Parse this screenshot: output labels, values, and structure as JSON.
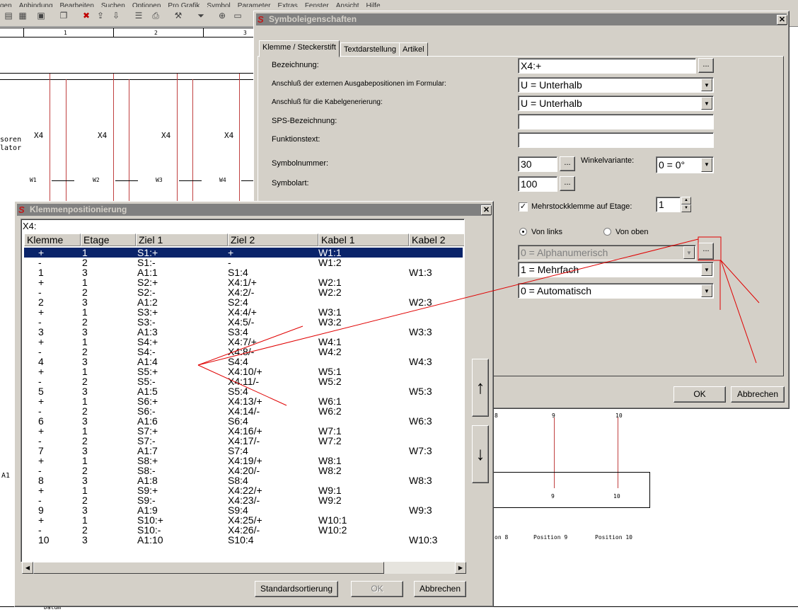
{
  "menubar": [
    "gen",
    "Anbindung",
    "Bearbeiten",
    "Suchen",
    "Optionen",
    "Pro Grafik",
    "Symbol",
    "Parameter",
    "Extras",
    "Fenster",
    "Ansicht",
    "Hilfe"
  ],
  "ruler": [
    "1",
    "2",
    "3"
  ],
  "schematic": {
    "side_text_1": "soren",
    "side_text_2": "lator",
    "terminals": [
      "X4",
      "X4",
      "X4",
      "X4"
    ],
    "wires": [
      "W1",
      "W2",
      "W3",
      "W4"
    ],
    "a1_label": "A1",
    "lower_nums": [
      "8",
      "9",
      "10"
    ],
    "lower_box_nums": [
      "9",
      "10"
    ],
    "positions": [
      "on 8",
      "Position 9",
      "Position 10"
    ],
    "bottom_left": "Datum"
  },
  "symbol_dialog": {
    "title": "Symboleigenschaften",
    "tabs": [
      "Klemme / Steckerstift",
      "Textdarstellung",
      "Artikel"
    ],
    "fields": {
      "bezeichnung_label": "Bezeichnung:",
      "bezeichnung_value": "X4:+",
      "anschluss_formular_label": "Anschluß der externen Ausgabepositionen im Formular:",
      "anschluss_formular_value": "U = Unterhalb",
      "anschluss_kabel_label": "Anschluß für die Kabelgenerierung:",
      "anschluss_kabel_value": "U = Unterhalb",
      "sps_label": "SPS-Bezeichnung:",
      "sps_value": "",
      "funktion_label": "Funktionstext:",
      "funktion_value": "",
      "symbolnummer_label": "Symbolnummer:",
      "symbolnummer_value": "30",
      "winkel_label": "Winkelvariante:",
      "winkel_value": "0 = 0°",
      "symbolart_label": "Symbolart:",
      "symbolart_value": "100",
      "mehrstock_label": "Mehrstockklemme auf Etage:",
      "mehrstock_checked": true,
      "etage_value": "1",
      "von_links_label": "Von links",
      "von_oben_label": "Von oben",
      "sort_value": "0 = Alphanumerisch",
      "mehrfach_value": "1 = Mehrfach",
      "auto_value": "0 = Automatisch"
    },
    "ellipsis": "...",
    "ok_label": "OK",
    "cancel_label": "Abbrechen"
  },
  "klemmen_dialog": {
    "title": "Klemmenpositionierung",
    "group": "X4:",
    "columns": [
      "Klemme",
      "Etage",
      "Ziel 1",
      "Ziel 2",
      "Kabel 1",
      "Kabel 2"
    ],
    "rows": [
      [
        "+",
        "1",
        "S1:+",
        "+",
        "W1:1",
        ""
      ],
      [
        "-",
        "2",
        "S1:-",
        "-",
        "W1:2",
        ""
      ],
      [
        "1",
        "3",
        "A1:1",
        "S1:4",
        "",
        "W1:3"
      ],
      [
        "+",
        "1",
        "S2:+",
        "X4:1/+",
        "W2:1",
        ""
      ],
      [
        "-",
        "2",
        "S2:-",
        "X4:2/-",
        "W2:2",
        ""
      ],
      [
        "2",
        "3",
        "A1:2",
        "S2:4",
        "",
        "W2:3"
      ],
      [
        "+",
        "1",
        "S3:+",
        "X4:4/+",
        "W3:1",
        ""
      ],
      [
        "-",
        "2",
        "S3:-",
        "X4:5/-",
        "W3:2",
        ""
      ],
      [
        "3",
        "3",
        "A1:3",
        "S3:4",
        "",
        "W3:3"
      ],
      [
        "+",
        "1",
        "S4:+",
        "X4:7/+",
        "W4:1",
        ""
      ],
      [
        "-",
        "2",
        "S4:-",
        "X4:8/-",
        "W4:2",
        ""
      ],
      [
        "4",
        "3",
        "A1:4",
        "S4:4",
        "",
        "W4:3"
      ],
      [
        "+",
        "1",
        "S5:+",
        "X4:10/+",
        "W5:1",
        ""
      ],
      [
        "-",
        "2",
        "S5:-",
        "X4:11/-",
        "W5:2",
        ""
      ],
      [
        "5",
        "3",
        "A1:5",
        "S5:4",
        "",
        "W5:3"
      ],
      [
        "+",
        "1",
        "S6:+",
        "X4:13/+",
        "W6:1",
        ""
      ],
      [
        "-",
        "2",
        "S6:-",
        "X4:14/-",
        "W6:2",
        ""
      ],
      [
        "6",
        "3",
        "A1:6",
        "S6:4",
        "",
        "W6:3"
      ],
      [
        "+",
        "1",
        "S7:+",
        "X4:16/+",
        "W7:1",
        ""
      ],
      [
        "-",
        "2",
        "S7:-",
        "X4:17/-",
        "W7:2",
        ""
      ],
      [
        "7",
        "3",
        "A1:7",
        "S7:4",
        "",
        "W7:3"
      ],
      [
        "+",
        "1",
        "S8:+",
        "X4:19/+",
        "W8:1",
        ""
      ],
      [
        "-",
        "2",
        "S8:-",
        "X4:20/-",
        "W8:2",
        ""
      ],
      [
        "8",
        "3",
        "A1:8",
        "S8:4",
        "",
        "W8:3"
      ],
      [
        "+",
        "1",
        "S9:+",
        "X4:22/+",
        "W9:1",
        ""
      ],
      [
        "-",
        "2",
        "S9:-",
        "X4:23/-",
        "W9:2",
        ""
      ],
      [
        "9",
        "3",
        "A1:9",
        "S9:4",
        "",
        "W9:3"
      ],
      [
        "+",
        "1",
        "S10:+",
        "X4:25/+",
        "W10:1",
        ""
      ],
      [
        "-",
        "2",
        "S10:-",
        "X4:26/-",
        "W10:2",
        ""
      ],
      [
        "10",
        "3",
        "A1:10",
        "S10:4",
        "",
        "W10:3"
      ]
    ],
    "selected_row": 0,
    "default_sort_label": "Standardsortierung",
    "ok_label": "OK",
    "cancel_label": "Abbrechen"
  },
  "colors": {
    "accent_selection": "#0a246a",
    "titlebar_inactive": "#808080",
    "annotation": "#e00000"
  }
}
